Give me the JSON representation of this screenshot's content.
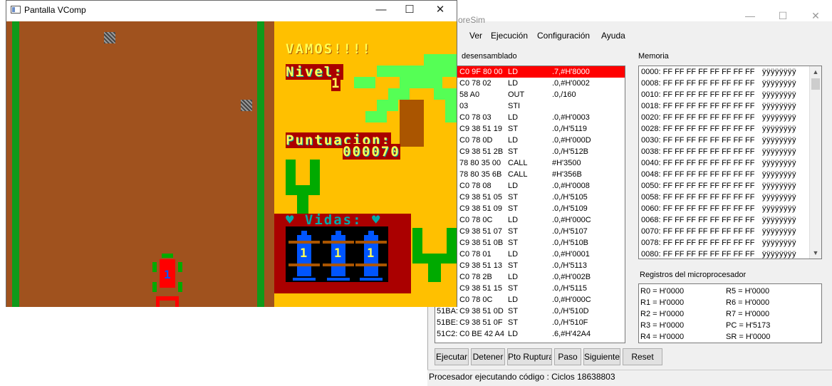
{
  "coresim": {
    "title": "oreSim",
    "window_buttons": {
      "minimize": "—",
      "maximize": "☐",
      "close": "✕"
    },
    "menu": [
      "Ver",
      "Ejecución",
      "Configuración",
      "Ayuda"
    ],
    "disasm_label": "desensamblado",
    "disasm": [
      {
        "addr": "",
        "bytes": "C0 9F 80 00",
        "op": "LD",
        "args": ".7,#H'8000",
        "selected": true
      },
      {
        "addr": "",
        "bytes": "C0 78 02",
        "op": "LD",
        "args": ".0,#H'0002"
      },
      {
        "addr": "",
        "bytes": "58 A0",
        "op": "OUT",
        "args": ".0,/160"
      },
      {
        "addr": "",
        "bytes": "03",
        "op": "STI",
        "args": ""
      },
      {
        "addr": "",
        "bytes": "C0 78 03",
        "op": "LD",
        "args": ".0,#H'0003"
      },
      {
        "addr": "",
        "bytes": "C9 38 51 19",
        "op": "ST",
        "args": ".0,/H'5119"
      },
      {
        "addr": "",
        "bytes": "C0 78 0D",
        "op": "LD",
        "args": ".0,#H'000D"
      },
      {
        "addr": "",
        "bytes": "C9 38 51 2B",
        "op": "ST",
        "args": ".0,/H'512B"
      },
      {
        "addr": "",
        "bytes": "78 80 35 00",
        "op": "CALL",
        "args": "#H'3500"
      },
      {
        "addr": "",
        "bytes": "78 80 35 6B",
        "op": "CALL",
        "args": "#H'356B"
      },
      {
        "addr": "",
        "bytes": "C0 78 08",
        "op": "LD",
        "args": ".0,#H'0008"
      },
      {
        "addr": "",
        "bytes": "C9 38 51 05",
        "op": "ST",
        "args": ".0,/H'5105"
      },
      {
        "addr": "",
        "bytes": "C9 38 51 09",
        "op": "ST",
        "args": ".0,/H'5109"
      },
      {
        "addr": "",
        "bytes": "C0 78 0C",
        "op": "LD",
        "args": ".0,#H'000C"
      },
      {
        "addr": "",
        "bytes": "C9 38 51 07",
        "op": "ST",
        "args": ".0,/H'5107"
      },
      {
        "addr": "",
        "bytes": "C9 38 51 0B",
        "op": "ST",
        "args": ".0,/H'510B"
      },
      {
        "addr": "",
        "bytes": "C0 78 01",
        "op": "LD",
        "args": ".0,#H'0001"
      },
      {
        "addr": "",
        "bytes": "C9 38 51 13",
        "op": "ST",
        "args": ".0,/H'5113"
      },
      {
        "addr": "",
        "bytes": "C0 78 2B",
        "op": "LD",
        "args": ".0,#H'002B"
      },
      {
        "addr": "",
        "bytes": "C9 38 51 15",
        "op": "ST",
        "args": ".0,/H'5115"
      },
      {
        "addr": "",
        "bytes": "C0 78 0C",
        "op": "LD",
        "args": ".0,#H'000C"
      },
      {
        "addr": "51BA:",
        "bytes": "C9 38 51 0D",
        "op": "ST",
        "args": ".0,/H'510D"
      },
      {
        "addr": "51BE:",
        "bytes": "C9 38 51 0F",
        "op": "ST",
        "args": ".0,/H'510F"
      },
      {
        "addr": "51C2:",
        "bytes": "C0 BE 42 A4",
        "op": "LD",
        "args": ".6,#H'42A4"
      }
    ],
    "memory_label": "Memoria",
    "memory": [
      {
        "addr": "0000:",
        "bytes": "FF FF FF FF FF FF FF FF",
        "chars": "ÿÿÿÿÿÿÿÿ"
      },
      {
        "addr": "0008:",
        "bytes": "FF FF FF FF FF FF FF FF",
        "chars": "ÿÿÿÿÿÿÿÿ"
      },
      {
        "addr": "0010:",
        "bytes": "FF FF FF FF FF FF FF FF",
        "chars": "ÿÿÿÿÿÿÿÿ"
      },
      {
        "addr": "0018:",
        "bytes": "FF FF FF FF FF FF FF FF",
        "chars": "ÿÿÿÿÿÿÿÿ"
      },
      {
        "addr": "0020:",
        "bytes": "FF FF FF FF FF FF FF FF",
        "chars": "ÿÿÿÿÿÿÿÿ"
      },
      {
        "addr": "0028:",
        "bytes": "FF FF FF FF FF FF FF FF",
        "chars": "ÿÿÿÿÿÿÿÿ"
      },
      {
        "addr": "0030:",
        "bytes": "FF FF FF FF FF FF FF FF",
        "chars": "ÿÿÿÿÿÿÿÿ"
      },
      {
        "addr": "0038:",
        "bytes": "FF FF FF FF FF FF FF FF",
        "chars": "ÿÿÿÿÿÿÿÿ"
      },
      {
        "addr": "0040:",
        "bytes": "FF FF FF FF FF FF FF FF",
        "chars": "ÿÿÿÿÿÿÿÿ"
      },
      {
        "addr": "0048:",
        "bytes": "FF FF FF FF FF FF FF FF",
        "chars": "ÿÿÿÿÿÿÿÿ"
      },
      {
        "addr": "0050:",
        "bytes": "FF FF FF FF FF FF FF FF",
        "chars": "ÿÿÿÿÿÿÿÿ"
      },
      {
        "addr": "0058:",
        "bytes": "FF FF FF FF FF FF FF FF",
        "chars": "ÿÿÿÿÿÿÿÿ"
      },
      {
        "addr": "0060:",
        "bytes": "FF FF FF FF FF FF FF FF",
        "chars": "ÿÿÿÿÿÿÿÿ"
      },
      {
        "addr": "0068:",
        "bytes": "FF FF FF FF FF FF FF FF",
        "chars": "ÿÿÿÿÿÿÿÿ"
      },
      {
        "addr": "0070:",
        "bytes": "FF FF FF FF FF FF FF FF",
        "chars": "ÿÿÿÿÿÿÿÿ"
      },
      {
        "addr": "0078:",
        "bytes": "FF FF FF FF FF FF FF FF",
        "chars": "ÿÿÿÿÿÿÿÿ"
      },
      {
        "addr": "0080:",
        "bytes": "FF FF FF FF FF FF FF FF",
        "chars": "ÿÿÿÿÿÿÿÿ"
      }
    ],
    "registers_label": "Registros del microprocesador",
    "registers": [
      {
        "left": "R0 = H'0000",
        "right": "R5 = H'0000"
      },
      {
        "left": "R1 = H'0000",
        "right": "R6 = H'0000"
      },
      {
        "left": "R2 = H'0000",
        "right": "R7 = H'0000"
      },
      {
        "left": "R3 = H'0000",
        "right": "PC = H'5173"
      },
      {
        "left": "R4 = H'0000",
        "right": "SR = H'0000"
      }
    ],
    "buttons": [
      "Ejecutar",
      "Detener",
      "Pto Ruptura",
      "Paso",
      "Siguiente",
      "Reset"
    ],
    "status": "Procesador ejecutando código : Ciclos 18638803",
    "selected_row_color": "#ff0000"
  },
  "game": {
    "title": "Pantalla VComp",
    "window_buttons": {
      "minimize": "—",
      "maximize": "☐",
      "close": "✕"
    },
    "vamos": "VAMOS!!!!",
    "nivel_label": "Nivel:",
    "nivel_value": "1",
    "puntuacion_label": "Puntuacion:",
    "puntuacion_value": "000070",
    "vidas_label": "♥ Vidas: ♥",
    "car_number": "1",
    "lives_numbers": [
      "1",
      "1",
      "1"
    ],
    "colors": {
      "track": "#a0521e",
      "border": "#0f9a1a",
      "hud": "#ffc000",
      "hud_text": "#ffff55",
      "cactus": "#00aa00",
      "lives_bg": "#aa0000",
      "car_red": "#ff0000",
      "car_blue": "#0055ff"
    }
  }
}
